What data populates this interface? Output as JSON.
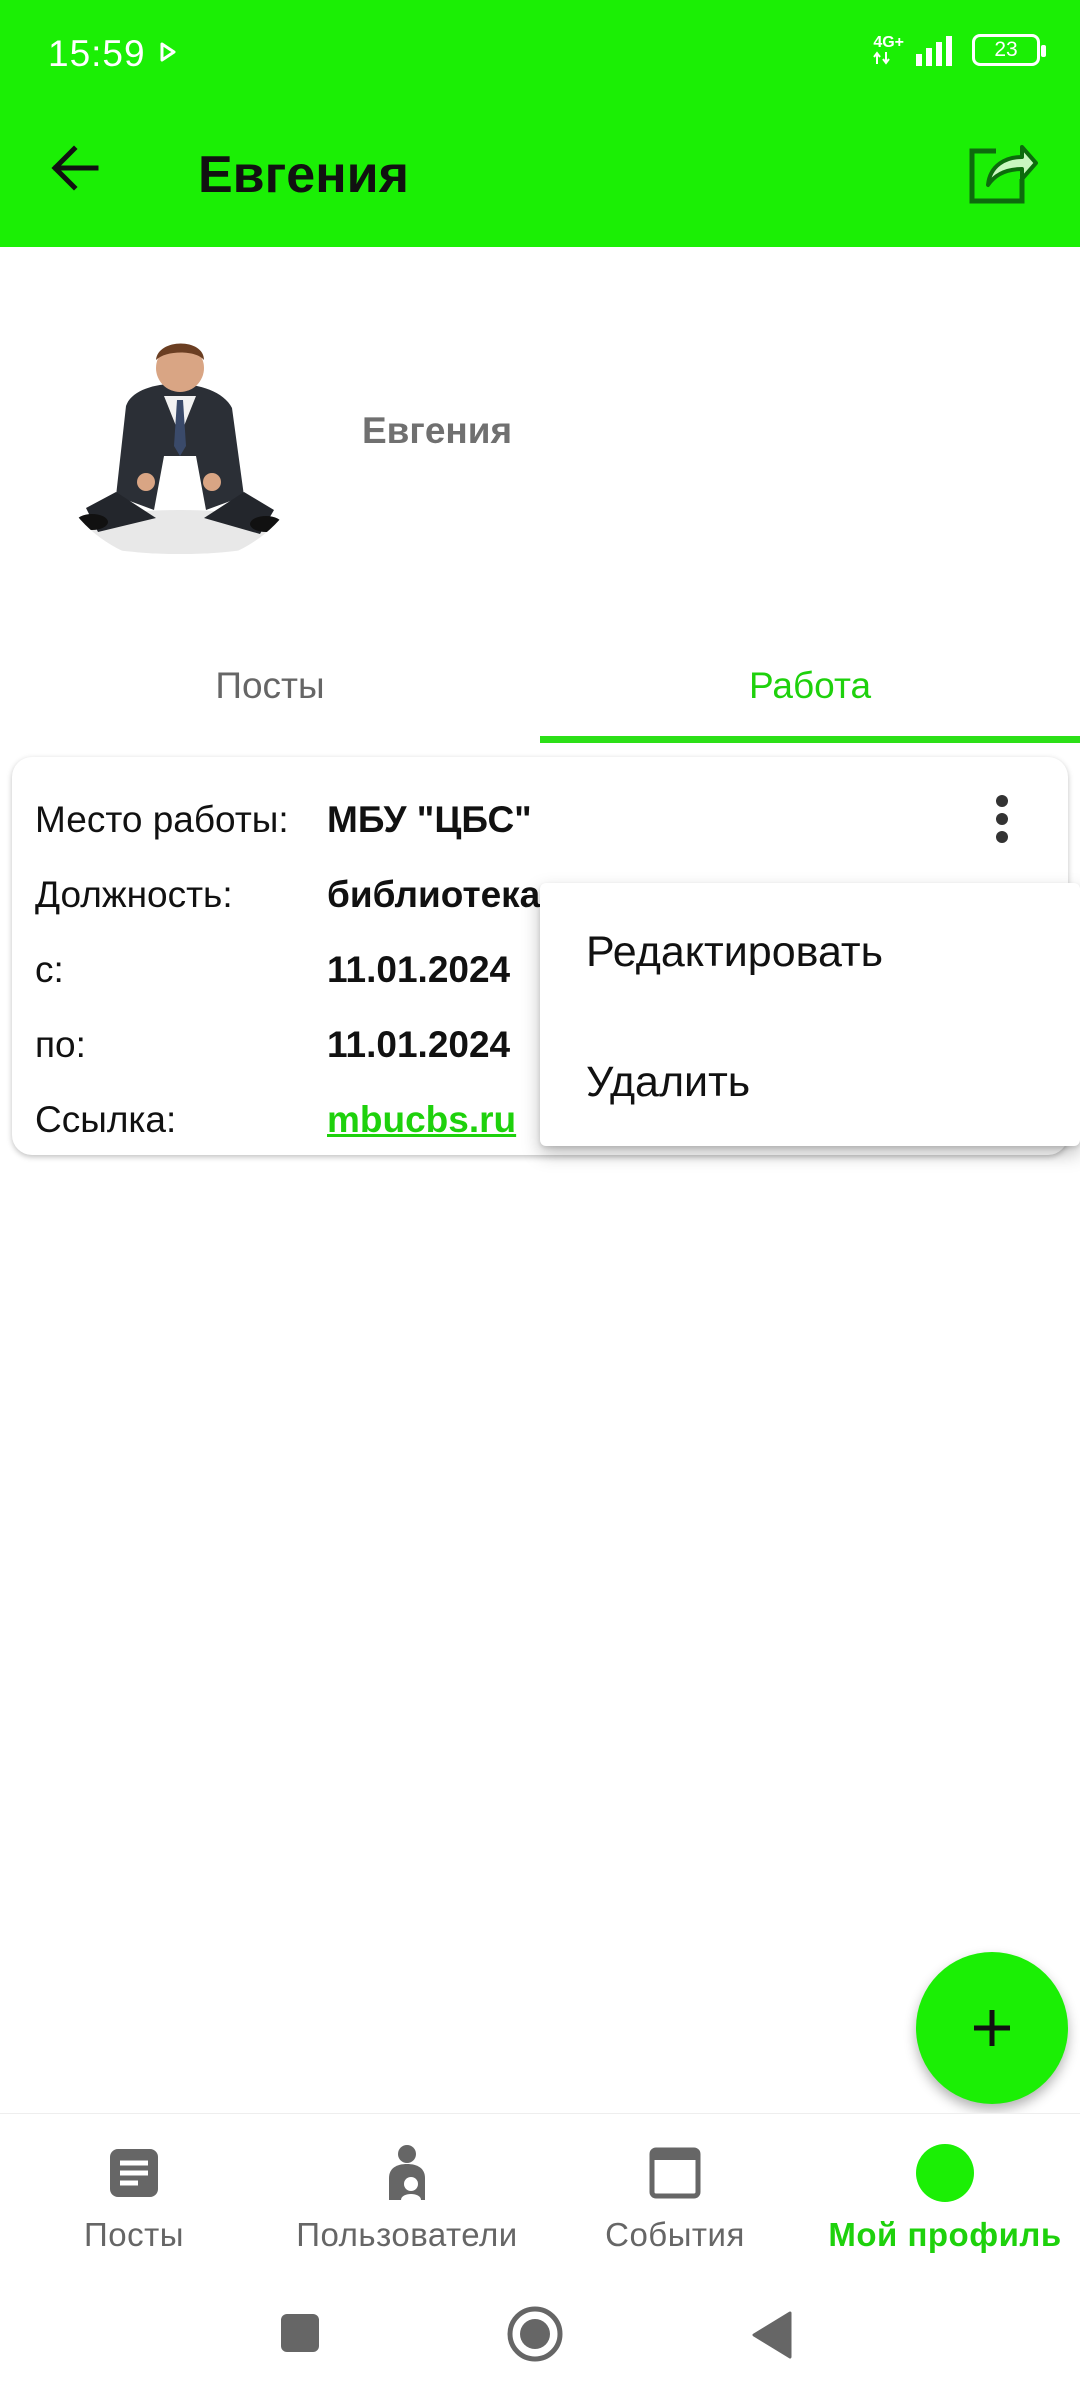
{
  "status_bar": {
    "time": "15:59",
    "network": "4G+",
    "battery": "23"
  },
  "app_bar": {
    "title": "Евгения",
    "back_icon": "arrow-back-icon",
    "share_icon": "share-icon"
  },
  "profile": {
    "name": "Евгения"
  },
  "tabs": [
    {
      "label": "Посты",
      "active": false
    },
    {
      "label": "Работа",
      "active": true
    }
  ],
  "work_card": {
    "rows": [
      {
        "label": "Место работы:",
        "value": "МБУ \"ЦБС\""
      },
      {
        "label": "Должность:",
        "value": "библиотекар"
      },
      {
        "label": "с:",
        "value": "11.01.2024"
      },
      {
        "label": "по:",
        "value": "11.01.2024"
      },
      {
        "label": "Ссылка:",
        "value": "mbucbs.ru"
      }
    ]
  },
  "popup_menu": {
    "items": [
      "Редактировать",
      "Удалить"
    ]
  },
  "fab": {
    "icon": "plus-icon"
  },
  "bottom_nav": {
    "items": [
      {
        "label": "Посты",
        "icon": "document-icon",
        "active": false
      },
      {
        "label": "Пользователи",
        "icon": "users-icon",
        "active": false
      },
      {
        "label": "События",
        "icon": "calendar-icon",
        "active": false
      },
      {
        "label": "Мой профиль",
        "icon": "profile-icon",
        "active": true
      }
    ]
  },
  "colors": {
    "accent": "#1bef05",
    "accent_text": "#1ed10c",
    "text": "#111111",
    "muted": "#666666"
  }
}
